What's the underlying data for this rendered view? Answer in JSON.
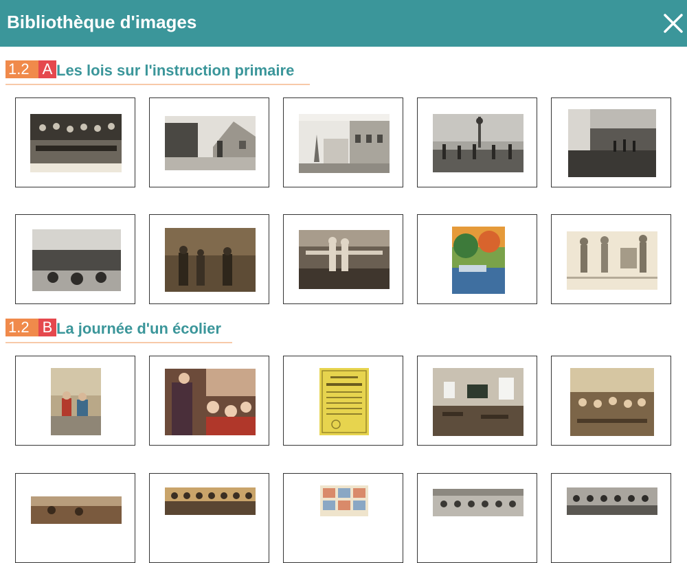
{
  "header": {
    "title": "Bibliothèque d'images",
    "close_icon": "close-icon"
  },
  "sections": [
    {
      "number": "1.2",
      "letter": "A",
      "title": "Les lois sur l'instruction primaire",
      "images": [
        {
          "name": "classroom-photo"
        },
        {
          "name": "village-street-postcard"
        },
        {
          "name": "town-square-postcard"
        },
        {
          "name": "crowd-gathering-photo"
        },
        {
          "name": "farm-scene-photo"
        },
        {
          "name": "workshop-photo"
        },
        {
          "name": "miners-photo"
        },
        {
          "name": "textile-mill-photo"
        },
        {
          "name": "landscape-painting"
        },
        {
          "name": "illustration-drawing"
        }
      ]
    },
    {
      "number": "1.2",
      "letter": "B",
      "title": "La journée d'un écolier",
      "images": [
        {
          "name": "children-painting"
        },
        {
          "name": "teacher-painting"
        },
        {
          "name": "certificate-document"
        },
        {
          "name": "old-classroom-photo"
        },
        {
          "name": "classroom-painting"
        },
        {
          "name": "school-canteen-photo"
        },
        {
          "name": "class-group-photo"
        },
        {
          "name": "comic-poster"
        },
        {
          "name": "school-group-photo-1"
        },
        {
          "name": "school-group-photo-2"
        }
      ]
    }
  ],
  "colors": {
    "header_bg": "#3b969a",
    "badge_number": "#f08a4b",
    "badge_letter": "#e5484d",
    "section_title": "#3b969a"
  }
}
